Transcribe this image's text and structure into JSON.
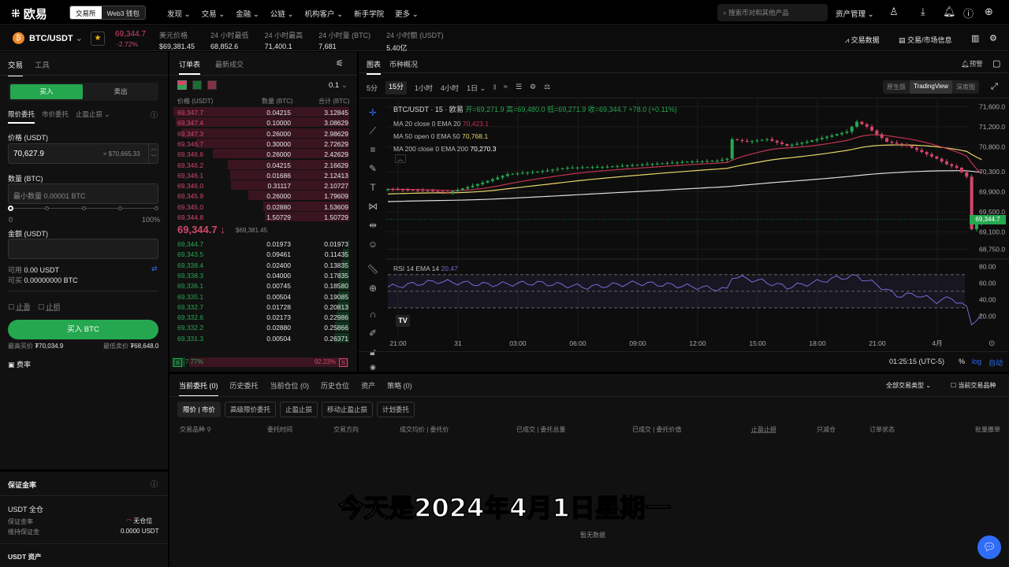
{
  "nav": {
    "brand": "欧易",
    "exchange_tab": "交易所",
    "wallet_tab": "Web3 钱包",
    "menu": [
      "发现",
      "交易",
      "金融",
      "公链",
      "机构客户",
      "新手学院",
      "更多"
    ],
    "search_placeholder": "搜索币对和其他产品",
    "asset_mgmt": "资产管理"
  },
  "ticker": {
    "pair": "BTC/USDT",
    "price": "69,344.7",
    "change": "-2.72%",
    "stats": [
      {
        "label": "美元价格",
        "value": "$69,381.45"
      },
      {
        "label": "24 小时最低",
        "value": "68,852.6"
      },
      {
        "label": "24 小时最高",
        "value": "71,400.1"
      },
      {
        "label": "24 小时量 (BTC)",
        "value": "7,681"
      },
      {
        "label": "24 小时额 (USDT)",
        "value": "5.40亿"
      }
    ],
    "trade_data": "交易数据",
    "market_info": "交易/市场信息"
  },
  "trade": {
    "tabs": [
      "交易",
      "工具"
    ],
    "buy": "买入",
    "sell": "卖出",
    "order_types": [
      "限价委托",
      "市价委托",
      "止盈止损"
    ],
    "price_label": "价格 (USDT)",
    "price_value": "70,627.9",
    "price_usd": "≈ $70,665.33",
    "qty_label": "数量 (BTC)",
    "qty_placeholder": "最小数量 0.00001 BTC",
    "slider_min": "0",
    "slider_max": "100%",
    "slider_value": 0,
    "amount_label": "金额 (USDT)",
    "available_label": "可用",
    "available": "0.00 USDT",
    "can_buy_label": "可买",
    "can_buy": "0.00000000 BTC",
    "tp": "止盈",
    "sl": "止损",
    "submit": "买入 BTC",
    "max_buy_label": "最高买价",
    "max_buy": "₮70,034.9",
    "min_sell_label": "最低卖价",
    "min_sell": "₮68,648.0",
    "fee": "费率"
  },
  "margin": {
    "title": "保证金率",
    "mode": "USDT 全仓",
    "ratio_label": "保证金率",
    "ratio_value": "无仓位",
    "maint_label": "维持保证金",
    "maint_value": "0.0000 USDT",
    "assets": "USDT 资产"
  },
  "orderbook": {
    "tabs": [
      "订单表",
      "最新成交"
    ],
    "precision": "0.1",
    "headers": [
      "价格 (USDT)",
      "数量 (BTC)",
      "合计 (BTC)"
    ],
    "asks": [
      [
        "69,347.7",
        "0.04215",
        "3.12845"
      ],
      [
        "69,347.4",
        "0.10000",
        "3.08629"
      ],
      [
        "69,347.3",
        "0.26000",
        "2.98629"
      ],
      [
        "69,346.7",
        "0.30000",
        "2.72629"
      ],
      [
        "69,346.6",
        "0.26000",
        "2.42629"
      ],
      [
        "69,346.2",
        "0.04215",
        "2.16629"
      ],
      [
        "69,346.1",
        "0.01686",
        "2.12413"
      ],
      [
        "69,346.0",
        "0.31117",
        "2.10727"
      ],
      [
        "69,345.9",
        "0.26000",
        "1.79609"
      ],
      [
        "69,345.0",
        "0.02880",
        "1.53609"
      ],
      [
        "69,344.8",
        "1.50729",
        "1.50729"
      ]
    ],
    "last_price": "69,344.7",
    "last_usd": "$69,381.45",
    "bids": [
      [
        "69,344.7",
        "0.01973",
        "0.01973"
      ],
      [
        "69,343.5",
        "0.09461",
        "0.11435"
      ],
      [
        "69,338.4",
        "0.02400",
        "0.13835"
      ],
      [
        "69,338.3",
        "0.04000",
        "0.17835"
      ],
      [
        "69,336.1",
        "0.00745",
        "0.18580"
      ],
      [
        "69,335.1",
        "0.00504",
        "0.19085"
      ],
      [
        "69,332.7",
        "0.01728",
        "0.20813"
      ],
      [
        "69,332.6",
        "0.02173",
        "0.22986"
      ],
      [
        "69,332.2",
        "0.02880",
        "0.25866"
      ],
      [
        "69,331.3",
        "0.00504",
        "0.26371"
      ]
    ],
    "buy_label": "B",
    "buy_pct": "7.77%",
    "sell_label": "S",
    "sell_pct": "92.23%",
    "buy_ratio": 7.77
  },
  "chart": {
    "tabs": [
      "图表",
      "币种概况"
    ],
    "alert": "预警",
    "intervals": [
      "5分",
      "15分",
      "1小时",
      "4小时",
      "1日"
    ],
    "active_interval": "15分",
    "views": [
      "原生版",
      "TradingView",
      "深度图"
    ],
    "legend_title": "BTC/USDT · 15 · 欧易",
    "ohlc": "开=69,271.9 高=69,480.0 低=69,271.9 收=69,344.7 +78.0 (+0.11%)",
    "ma": [
      {
        "label": "MA 20 close 0 EMA 20",
        "value": "70,423.1",
        "color": "#c2334f"
      },
      {
        "label": "MA 50 open 0 EMA 50",
        "value": "70,768.1",
        "color": "#e8d66a"
      },
      {
        "label": "MA 200 close 0 EMA 200",
        "value": "70,270.3",
        "color": "#e6e6e6"
      }
    ],
    "rsi_label": "RSI 14 EMA 14",
    "rsi_value": "20.47",
    "time": "01:25:15 (UTC-5)",
    "pct": "%",
    "log": "log",
    "auto": "自动",
    "current_price": "69,344.7"
  },
  "chart_data": {
    "type": "candlestick",
    "interval": "15m",
    "y_ticks": [
      "71,600.0",
      "71,200.0",
      "70,800.0",
      "70,300.0",
      "69,900.0",
      "69,500.0",
      "69,100.0",
      "68,750.0"
    ],
    "ylim": [
      68600,
      71750
    ],
    "x_ticks": [
      "21:00",
      "31",
      "03:00",
      "06:00",
      "09:00",
      "12:00",
      "15:00",
      "18:00",
      "21:00",
      "4月"
    ],
    "close_keypoints": [
      [
        0,
        69950
      ],
      [
        8,
        69920
      ],
      [
        12,
        69880
      ],
      [
        18,
        70050
      ],
      [
        24,
        70250
      ],
      [
        30,
        70300
      ],
      [
        36,
        70380
      ],
      [
        44,
        70400
      ],
      [
        52,
        70450
      ],
      [
        60,
        70500
      ],
      [
        66,
        70520
      ],
      [
        68,
        70560
      ],
      [
        69,
        70950
      ],
      [
        72,
        70900
      ],
      [
        76,
        70950
      ],
      [
        80,
        70820
      ],
      [
        84,
        70900
      ],
      [
        88,
        71000
      ],
      [
        92,
        71100
      ],
      [
        94,
        71300
      ],
      [
        96,
        71200
      ],
      [
        98,
        71050
      ],
      [
        100,
        70900
      ],
      [
        104,
        70820
      ],
      [
        108,
        70650
      ],
      [
        110,
        70560
      ],
      [
        112,
        70450
      ],
      [
        114,
        70380
      ],
      [
        116,
        70200
      ],
      [
        117,
        69150
      ],
      [
        118,
        69250
      ],
      [
        119,
        69345
      ]
    ],
    "rsi_ticks": [
      "80.00",
      "60.00",
      "40.00",
      "20.00"
    ],
    "rsi_ylim": [
      10,
      85
    ],
    "rsi_keypoints": [
      [
        0,
        55
      ],
      [
        10,
        62
      ],
      [
        20,
        58
      ],
      [
        30,
        60
      ],
      [
        40,
        55
      ],
      [
        50,
        60
      ],
      [
        60,
        56
      ],
      [
        68,
        52
      ],
      [
        69,
        68
      ],
      [
        75,
        62
      ],
      [
        80,
        55
      ],
      [
        85,
        60
      ],
      [
        90,
        66
      ],
      [
        94,
        68
      ],
      [
        98,
        58
      ],
      [
        102,
        45
      ],
      [
        106,
        46
      ],
      [
        110,
        38
      ],
      [
        113,
        42
      ],
      [
        116,
        30
      ],
      [
        117,
        12
      ],
      [
        119,
        20
      ]
    ]
  },
  "orders": {
    "tabs": [
      "当前委托 (0)",
      "历史委托",
      "当前仓位 (0)",
      "历史仓位",
      "资产",
      "策略 (0)"
    ],
    "filter": "全部交易类型",
    "current_only": "当前交易品种",
    "subtabs": [
      "限价 | 市价",
      "高级限价委托",
      "止盈止损",
      "移动止盈止损",
      "计划委托"
    ],
    "columns": [
      "交易品种",
      "委托时间",
      "交易方向",
      "成交均价 | 委托价",
      "已成交 | 委托总量",
      "已成交 | 委托价值",
      "止盈止损",
      "只减仓",
      "订单状态",
      "批量撤单"
    ],
    "empty": "暂无数据"
  },
  "subtitle": "今天是2024年4月1日星期一",
  "colors": {
    "up": "#25a750",
    "down": "#d2476a",
    "accent": "#2f6df6"
  }
}
